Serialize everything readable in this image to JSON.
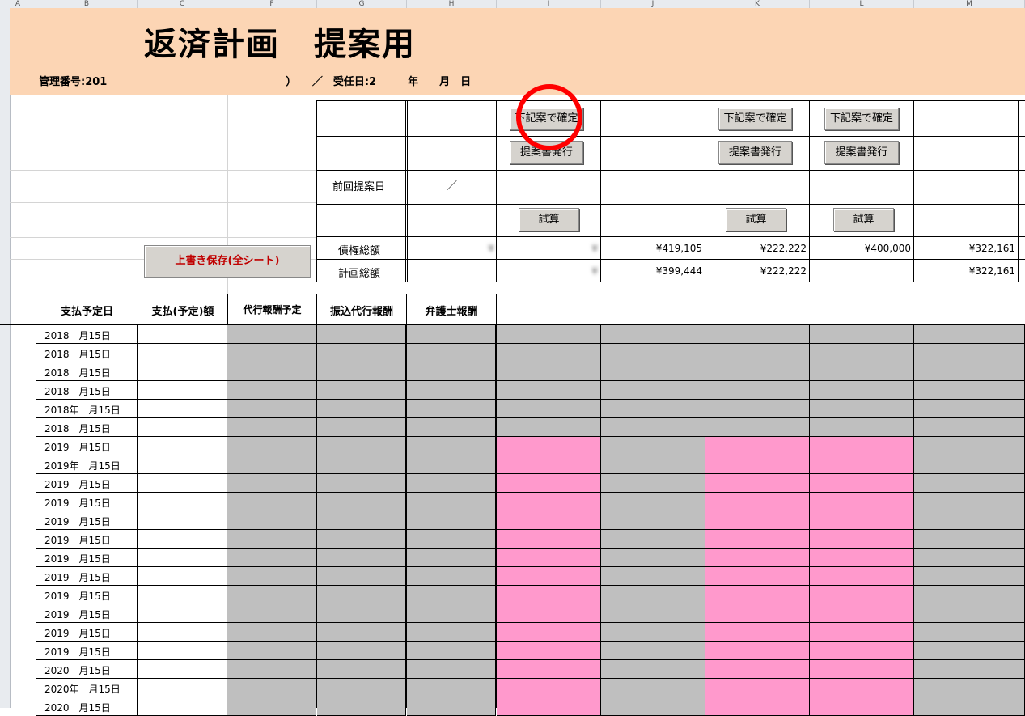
{
  "columns": [
    "A",
    "B",
    "C",
    "F",
    "G",
    "H",
    "I",
    "J",
    "K",
    "L",
    "M"
  ],
  "title": "返済計画　提案用",
  "meta": "管理番号:201　　　　　　　　　　　　　　　　　）　　／　受任日:2　　　年　　月　日",
  "buttons": {
    "confirm": "下記案で確定",
    "issue": "提案書発行",
    "calc": "試算",
    "save": "上書き保存(全シート)"
  },
  "labels": {
    "prev_date": "前回提案日",
    "prev_date_value": "／",
    "claim_total": "債権総額",
    "plan_total": "計画総額"
  },
  "claim_values": [
    "¥",
    "¥",
    "¥419,105",
    "¥222,222",
    "¥400,000",
    "¥322,161"
  ],
  "plan_values": [
    "¥",
    "¥399,444",
    "¥222,222",
    "",
    "¥322,161"
  ],
  "headers": [
    "支払予定日",
    "支払(予定)額",
    "代行報酬予定",
    "振込代行報酬",
    "弁護士報酬"
  ],
  "creditor_headers": [
    "",
    "",
    "",
    "",
    ""
  ],
  "dates": [
    "2018　月15日",
    "2018　月15日",
    "2018　月15日",
    "2018　月15日",
    "2018年　月15日",
    "2018　月15日",
    "2019　月15日",
    "2019年　月15日",
    "2019　月15日",
    "2019　月15日",
    "2019　月15日",
    "2019　月15日",
    "2019　月15日",
    "2019　月15日",
    "2019　月15日",
    "2019　月15日",
    "2019　月15日",
    "2019　月15日",
    "2020　月15日",
    "2020年　月15日",
    "2020　月15日"
  ],
  "colors": {
    "banner": "#fcd5b4",
    "gray": "#bfbfbf",
    "pink": "#ff99cc",
    "circle": "#ff0000"
  }
}
